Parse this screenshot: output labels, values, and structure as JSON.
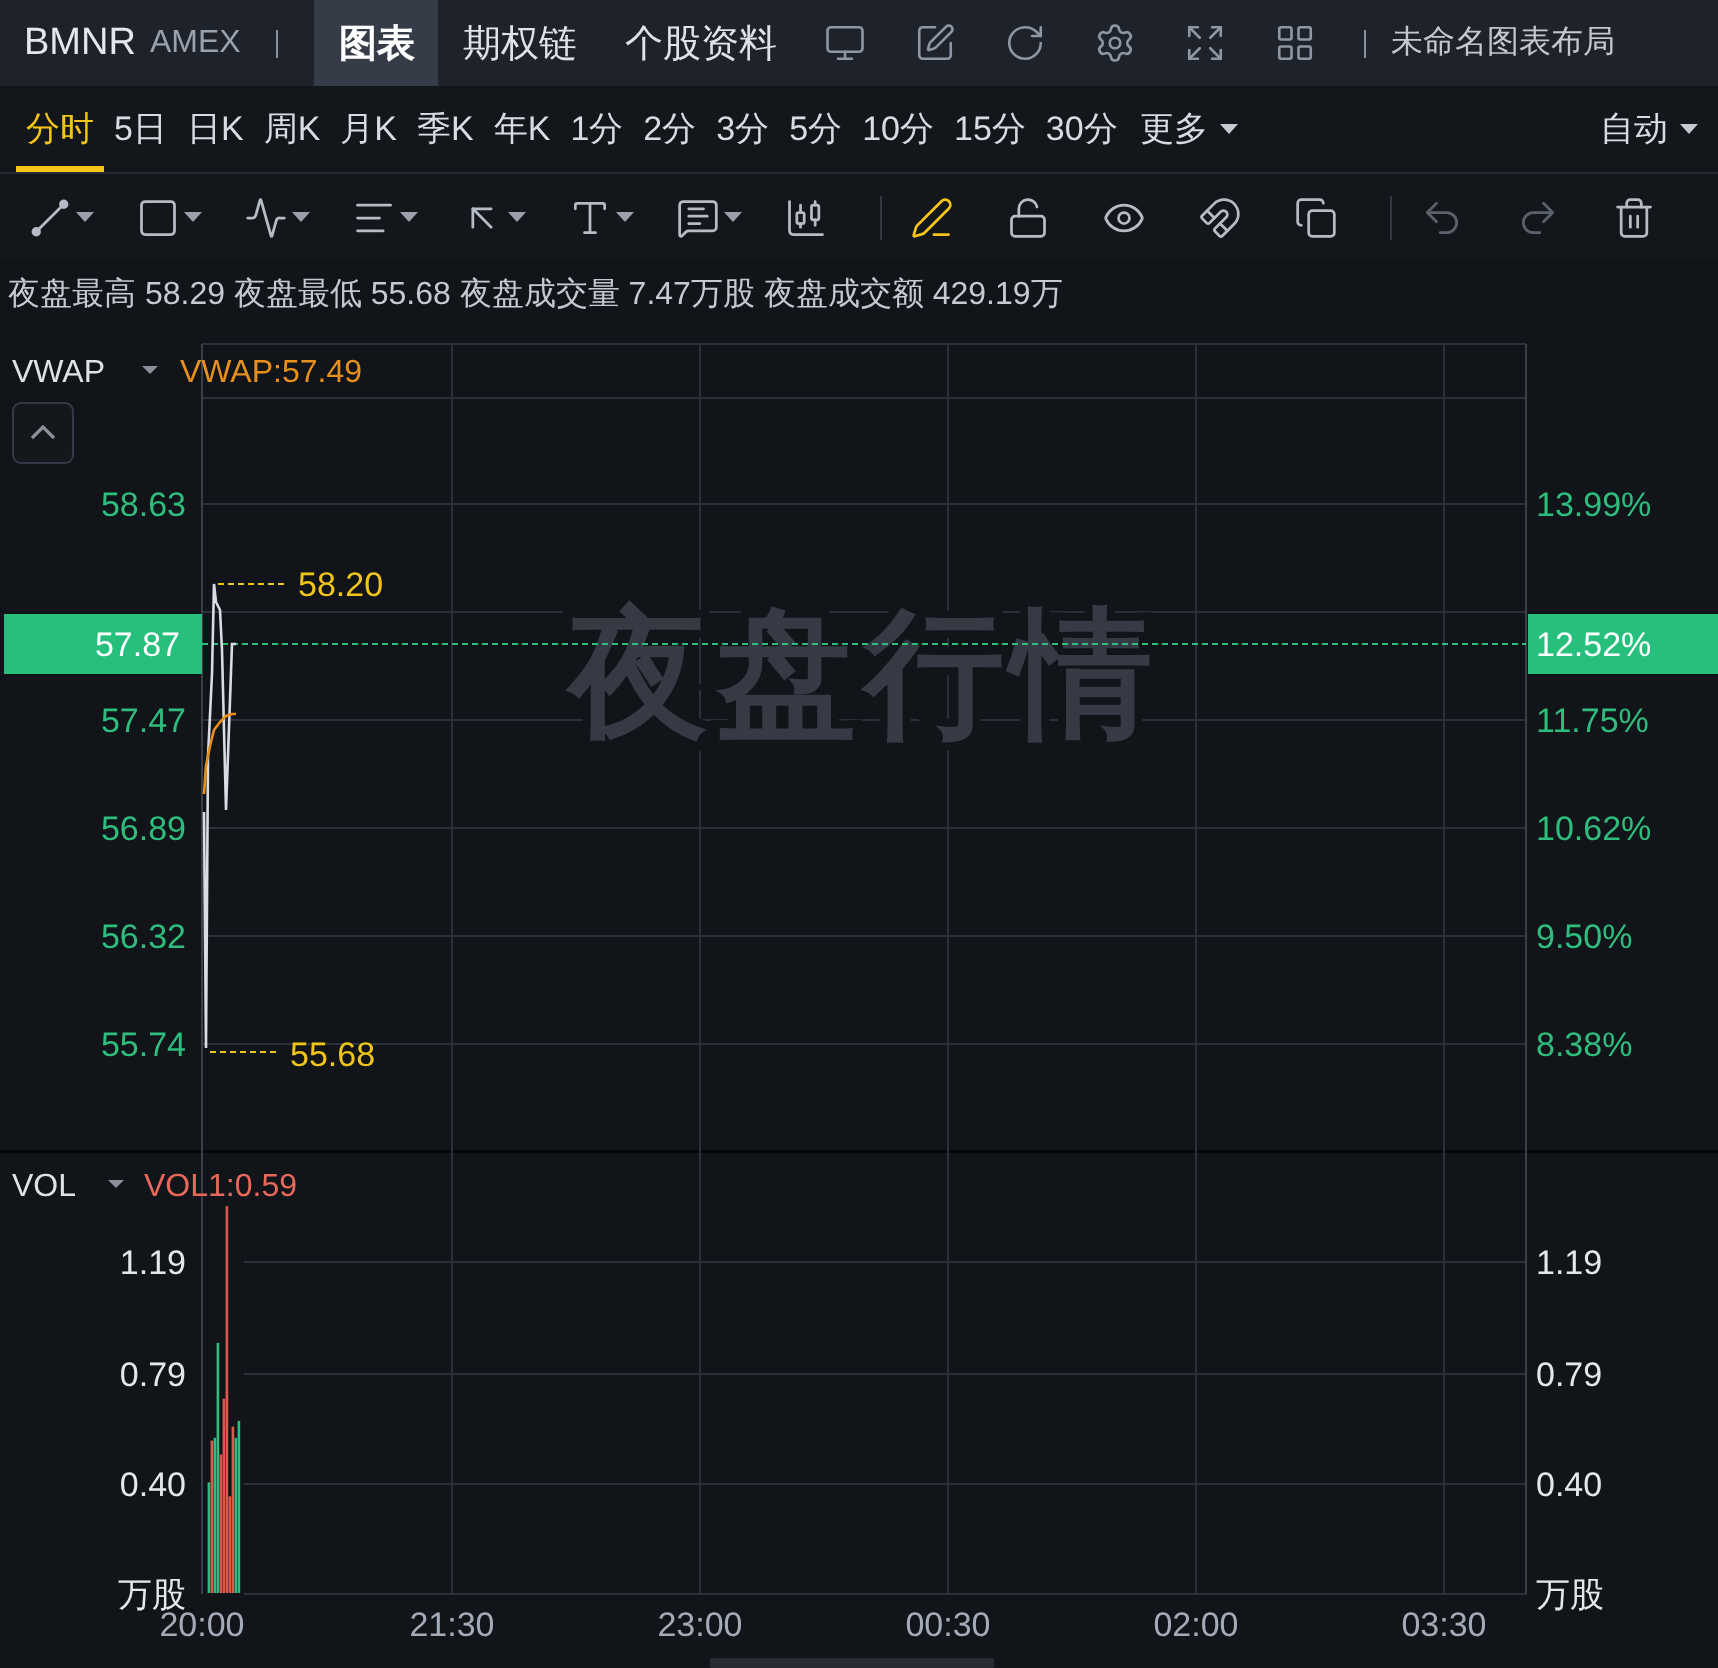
{
  "top_bar": {
    "symbol": "BMNR",
    "exchange": "AMEX",
    "tabs": [
      {
        "label": "图表",
        "selected": true
      },
      {
        "label": "期权链",
        "selected": false
      },
      {
        "label": "个股资料",
        "selected": false
      }
    ],
    "icons": [
      {
        "kind": "monitor"
      },
      {
        "kind": "edit"
      },
      {
        "kind": "refresh"
      },
      {
        "kind": "settings"
      },
      {
        "kind": "fullscreen"
      },
      {
        "kind": "grid"
      }
    ],
    "layout_name": "未命名图表布局"
  },
  "periods": [
    {
      "label": "分时",
      "selected": true
    },
    {
      "label": "5日",
      "selected": false
    },
    {
      "label": "日K",
      "selected": false
    },
    {
      "label": "周K",
      "selected": false
    },
    {
      "label": "月K",
      "selected": false
    },
    {
      "label": "季K",
      "selected": false
    },
    {
      "label": "年K",
      "selected": false
    },
    {
      "label": "1分",
      "selected": false
    },
    {
      "label": "2分",
      "selected": false
    },
    {
      "label": "3分",
      "selected": false
    },
    {
      "label": "5分",
      "selected": false
    },
    {
      "label": "10分",
      "selected": false
    },
    {
      "label": "15分",
      "selected": false
    },
    {
      "label": "30分",
      "selected": false
    }
  ],
  "more_menu": {
    "label": "更多"
  },
  "scale_menu": {
    "label": "自动"
  },
  "tools": [
    {
      "kind": "line",
      "has_menu": true,
      "selected": false,
      "disabled": false
    },
    {
      "kind": "rect",
      "has_menu": true,
      "selected": false,
      "disabled": false
    },
    {
      "kind": "wave",
      "has_menu": true,
      "selected": false,
      "disabled": false
    },
    {
      "kind": "fib",
      "has_menu": true,
      "selected": false,
      "disabled": false
    },
    {
      "kind": "arrow",
      "has_menu": true,
      "selected": false,
      "disabled": false
    },
    {
      "kind": "text",
      "has_menu": true,
      "selected": false,
      "disabled": false
    },
    {
      "kind": "note",
      "has_menu": true,
      "selected": false,
      "disabled": false
    },
    {
      "kind": "candles",
      "has_menu": false,
      "selected": false,
      "disabled": false
    },
    {
      "kind": "sep"
    },
    {
      "kind": "pen",
      "has_menu": false,
      "selected": true,
      "disabled": false
    },
    {
      "kind": "lock",
      "has_menu": false,
      "selected": false,
      "disabled": false
    },
    {
      "kind": "eye",
      "has_menu": false,
      "selected": false,
      "disabled": false
    },
    {
      "kind": "magnet",
      "has_menu": false,
      "selected": false,
      "disabled": false
    },
    {
      "kind": "layers",
      "has_menu": false,
      "selected": false,
      "disabled": false
    },
    {
      "kind": "sep"
    },
    {
      "kind": "undo",
      "has_menu": false,
      "selected": false,
      "disabled": true
    },
    {
      "kind": "redo",
      "has_menu": false,
      "selected": false,
      "disabled": true
    },
    {
      "kind": "delete",
      "has_menu": false,
      "selected": false,
      "disabled": false
    }
  ],
  "summary": "夜盘最高 58.29 夜盘最低 55.68 夜盘成交量 7.47万股 夜盘成交额 429.19万",
  "price_pane": {
    "indicator": "VWAP",
    "indicator_value": "VWAP:57.49",
    "watermark": "夜盘行情",
    "high_label": "58.20",
    "low_label": "55.68",
    "last_price": {
      "label": "57.87",
      "percent": "12.52%"
    },
    "left_axis_labels": [
      "58.63",
      "57.47",
      "56.89",
      "56.32",
      "55.74"
    ],
    "right_axis_labels": [
      "13.99%",
      "11.75%",
      "10.62%",
      "9.50%",
      "8.38%"
    ]
  },
  "volume_pane": {
    "indicator": "VOL",
    "indicator_value": "VOL1:0.59",
    "left_axis_labels": [
      "1.19",
      "0.79",
      "0.40",
      "万股"
    ],
    "right_axis_labels": [
      "1.19",
      "0.79",
      "0.40",
      "万股"
    ],
    "time_labels": [
      "20:00",
      "21:30",
      "23:00",
      "00:30",
      "02:00",
      "03:30"
    ]
  }
}
